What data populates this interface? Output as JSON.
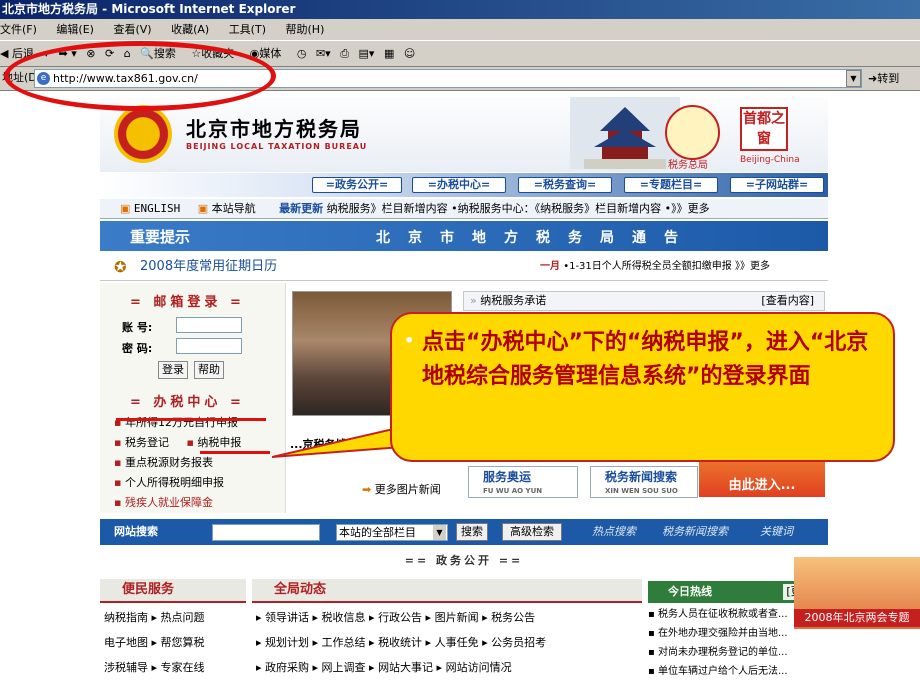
{
  "window": {
    "title": "北京市地方税务局 - Microsoft Internet Explorer"
  },
  "menu": {
    "items": [
      "文件(F)",
      "编辑(E)",
      "查看(V)",
      "收藏(A)",
      "工具(T)",
      "帮助(H)"
    ]
  },
  "toolbar": {
    "back_label": "后退",
    "search_label": "搜索",
    "favorites_label": "收藏夹",
    "media_label": "媒体"
  },
  "address": {
    "label": "地址(D)",
    "url": "http://www.tax861.gov.cn/",
    "go_label": "转到"
  },
  "banner": {
    "name_cn": "北京市地方税务局",
    "name_en": "BEIJING LOCAL TAXATION BUREAU",
    "shui_label": "税务总局",
    "capital_label": "首都之窗",
    "beijing_china": "Beijing-China"
  },
  "nav": {
    "tabs": [
      "=政务公开=",
      "=办税中心=",
      "=税务查询=",
      "=专题栏目=",
      "=子网站群="
    ]
  },
  "newsbar": {
    "english": "ENGLISH",
    "site_nav": "本站导航",
    "latest": "最新更新",
    "ticker": "纳税服务》栏目新增内容 •纳税服务中心：《纳税服务》栏目新增内容 •》》更多"
  },
  "notice": {
    "title": "重要提示",
    "message": "北京市地方税务局通告"
  },
  "calendar": {
    "title": "2008年度常用征期日历",
    "month": "一月",
    "item": "•1-31日个人所得税全员全额扣缴申报",
    "more": "》》更多"
  },
  "mail": {
    "title": "= 邮箱登录 =",
    "account_label": "账 号:",
    "password_label": "密 码:",
    "login": "登录",
    "help": "帮助"
  },
  "tax_center": {
    "title": "= 办税中心 =",
    "items": [
      "年所得12万元自行申报",
      "税务登记",
      "纳税申报",
      "重点税源财务报表",
      "个人所得税明细申报",
      "残疾人就业保障金"
    ]
  },
  "photo": {
    "caption_line1": "...京税务博物馆...",
    "more_label": "更多图片新闻"
  },
  "pledge": {
    "title": "纳税服务承诺",
    "view_label": "[查看内容]"
  },
  "promos": {
    "service": "服务奥运",
    "service_en": "FU WU AO YUN",
    "news_search": "税务新闻搜索",
    "news_search_en": "XIN WEN SOU SUO",
    "entry": "由此进入..."
  },
  "search": {
    "label": "网站搜索",
    "scope": "本站的全部栏目",
    "search_btn": "搜索",
    "advanced_btn": "高级检索",
    "hot": "热点搜索",
    "news": "税务新闻搜索",
    "keywords": "关键词"
  },
  "gov_open": {
    "label": "== 政务公开 =="
  },
  "convenience": {
    "title": "便民服务",
    "rows": [
      [
        "纳税指南",
        "热点问题"
      ],
      [
        "电子地图",
        "帮您算税"
      ],
      [
        "涉税辅导",
        "专家在线"
      ]
    ]
  },
  "overall": {
    "title": "全局动态",
    "rows": [
      [
        "领导讲话",
        "税收信息",
        "行政公告",
        "图片新闻",
        "税务公告"
      ],
      [
        "规划计划",
        "工作总结",
        "税收统计",
        "人事任免",
        "公务员招考"
      ],
      [
        "政府采购",
        "网上调查",
        "网站大事记",
        "网站访问情况"
      ]
    ]
  },
  "today": {
    "title": "今日热线",
    "more": "[更多]",
    "items": [
      "税务人员在征收税款或者查...",
      "在外地办理交强险并由当地...",
      "对尚未办理税务登记的单位...",
      "单位车辆过户给个人后无法..."
    ]
  },
  "sessions": {
    "label": "2008年北京两会专题"
  },
  "callout": {
    "text": "点击“办税中心”下的“纳税申报”，进入“北京地税综合服务管理信息系统”的登录界面"
  }
}
